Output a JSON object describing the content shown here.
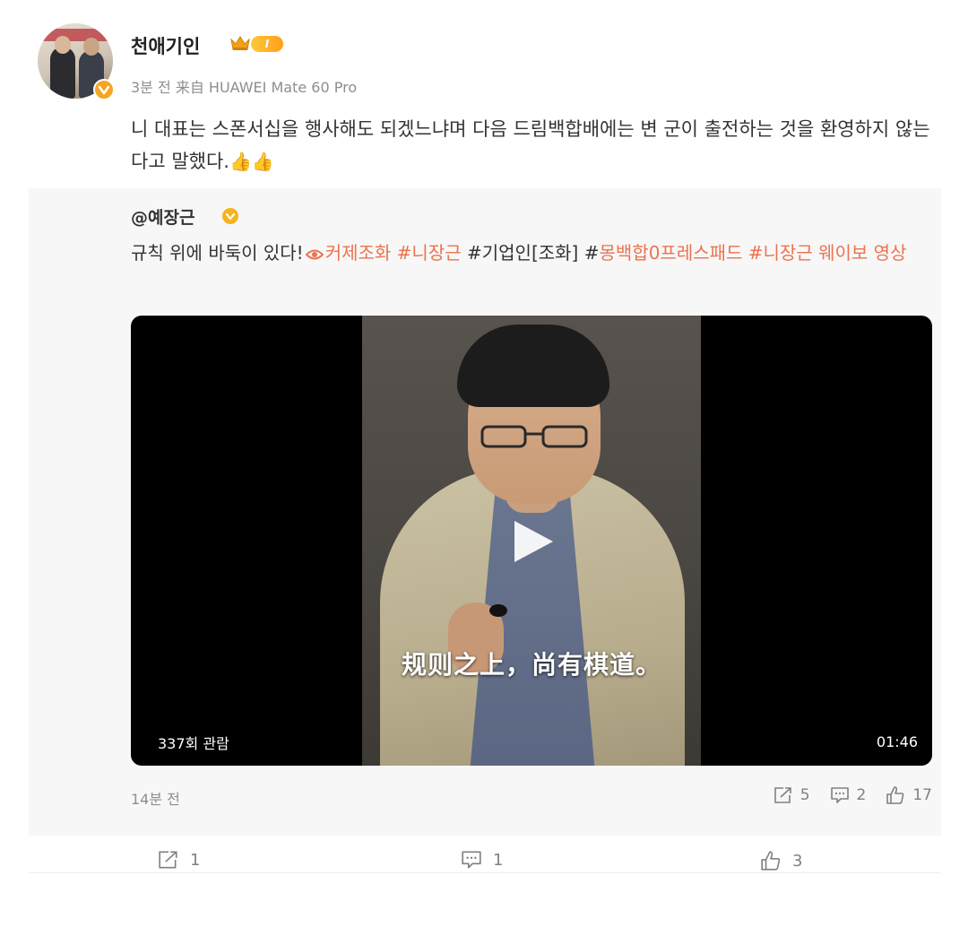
{
  "post": {
    "username": "천애기인",
    "level_badge": "I",
    "time": "3분 전",
    "source_prefix": "来自",
    "source": "HUAWEI Mate 60 Pro",
    "text": "니 대표는 스폰서십을 행사해도 되겠느냐며 다음 드림백합배에는 변 군이 출전하는 것을 환영하지 않는다고 말했다.",
    "thumbs": "👍👍"
  },
  "repost": {
    "username": "@예장근",
    "text_plain_1": "규칙 위에 바둑이 있다!",
    "tag_1": "커제조화",
    "tag_2": "#니장근",
    "text_plain_2": "#기업인[조화]",
    "tag_3_prefix": "#",
    "tag_3": "몽백합0프레스패드",
    "tag_4": "#니장근 웨이보 영상",
    "video": {
      "subtitle": "规则之上，尚有棋道。",
      "views": "337회 관람",
      "duration": "01:46"
    },
    "time": "14분 전",
    "actions": {
      "share_count": "5",
      "comment_count": "2",
      "like_count": "17"
    }
  },
  "actions": {
    "share_count": "1",
    "comment_count": "1",
    "like_count": "3"
  },
  "colors": {
    "accent": "#eb7350",
    "verified": "#f5a623",
    "muted": "#8e8e8e",
    "panel": "#f7f7f7"
  }
}
